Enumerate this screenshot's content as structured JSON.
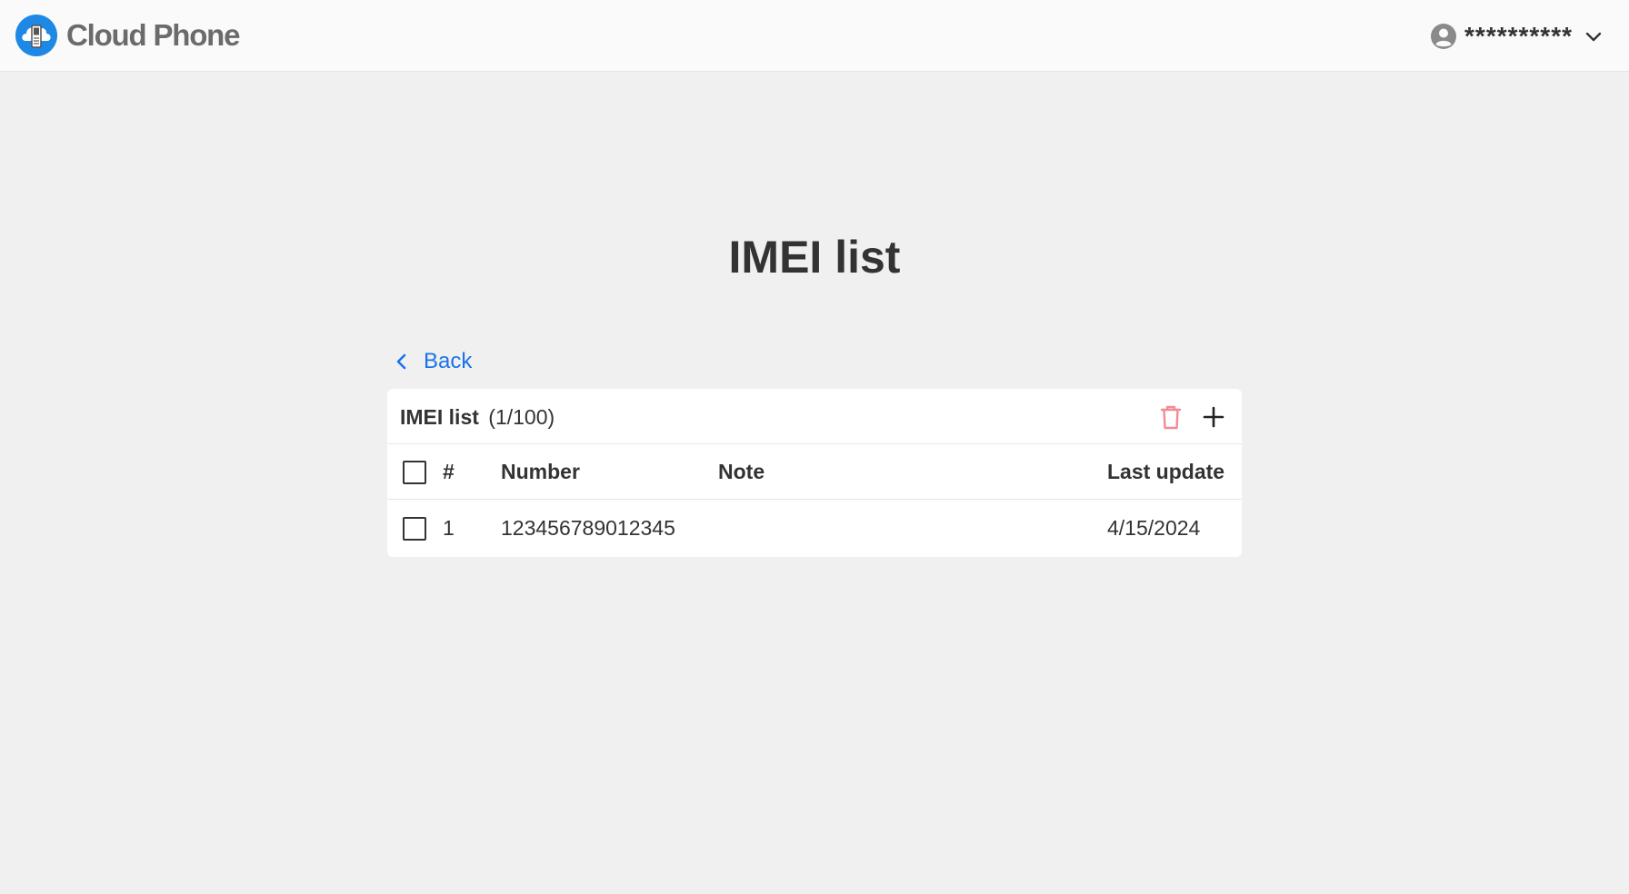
{
  "header": {
    "brand": "Cloud Phone",
    "user_name": "**********"
  },
  "page": {
    "title": "IMEI list",
    "back_label": "Back"
  },
  "card": {
    "title": "IMEI list",
    "count": "(1/100)"
  },
  "table": {
    "columns": {
      "index": "#",
      "number": "Number",
      "note": "Note",
      "last_update": "Last update"
    },
    "rows": [
      {
        "index": "1",
        "number": "123456789012345",
        "note": "",
        "last_update": "4/15/2024"
      }
    ]
  },
  "colors": {
    "accent": "#1a73e8",
    "brand_blue": "#1e88e5",
    "delete": "#f28b95",
    "background": "#f0f0f0"
  },
  "icons": {
    "logo": "cloud-phone-logo-icon",
    "user": "user-circle-icon",
    "dropdown": "chevron-down-icon",
    "back": "chevron-left-icon",
    "delete": "trash-icon",
    "add": "plus-icon"
  }
}
